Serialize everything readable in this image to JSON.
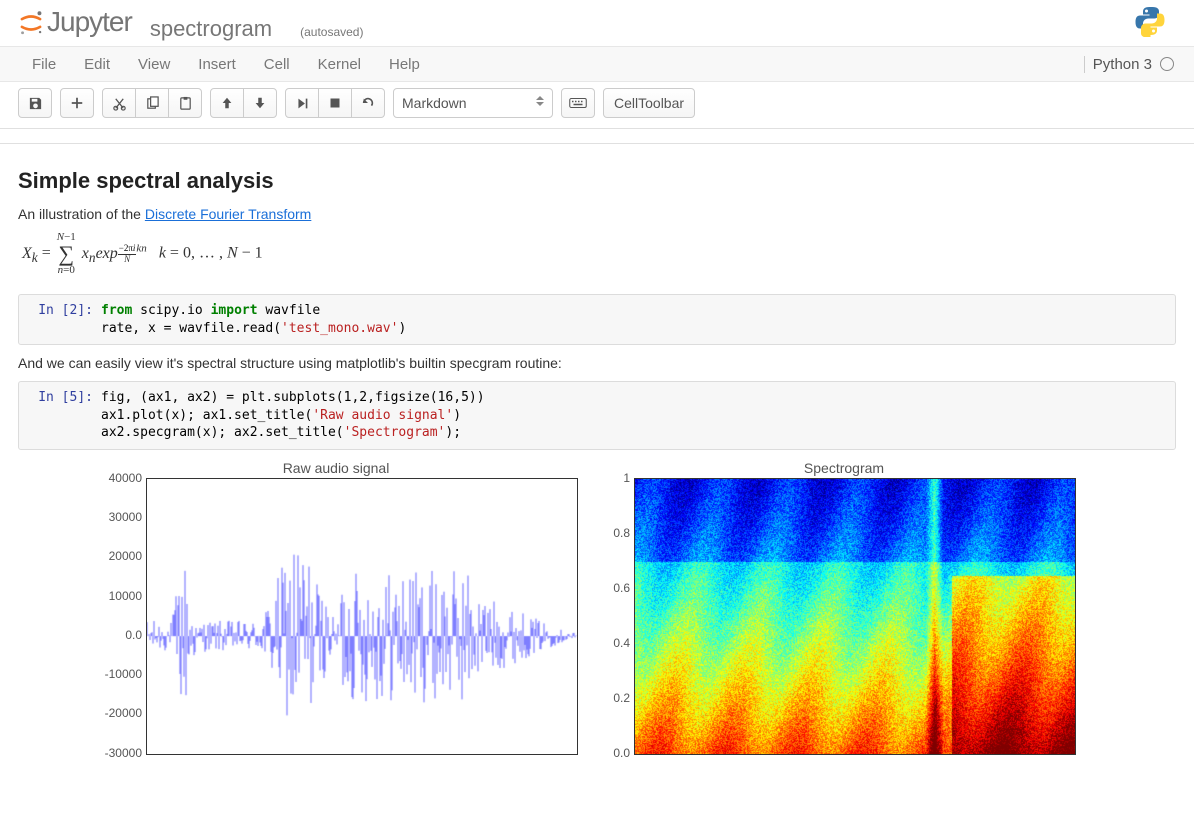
{
  "header": {
    "brand": "Jupyter",
    "notebook_name": "spectrogram",
    "autosave": "(autosaved)"
  },
  "menu": {
    "items": [
      "File",
      "Edit",
      "View",
      "Insert",
      "Cell",
      "Kernel",
      "Help"
    ]
  },
  "kernel": {
    "name": "Python 3"
  },
  "toolbar": {
    "cell_type": "Markdown",
    "celltoolbar_label": "CellToolbar"
  },
  "markdown": {
    "title": "Simple spectral analysis",
    "intro_prefix": "An illustration of the ",
    "intro_link": "Discrete Fourier Transform",
    "equation_caption": "Xk = Σ xn exp(−2πi/N kn)   k = 0,…,N−1",
    "mid_text": "And we can easily view it's spectral structure using matplotlib's builtin specgram routine:"
  },
  "cells": [
    {
      "type": "code",
      "prompt": "In [2]:",
      "lines": [
        [
          {
            "t": "from ",
            "cls": "kw"
          },
          {
            "t": "scipy.io ",
            "cls": "nm"
          },
          {
            "t": "import ",
            "cls": "kw"
          },
          {
            "t": "wavfile",
            "cls": "nm"
          }
        ],
        [
          {
            "t": "rate, x ",
            "cls": "nm"
          },
          {
            "t": "= ",
            "cls": "op"
          },
          {
            "t": "wavfile.read(",
            "cls": "nm"
          },
          {
            "t": "'test_mono.wav'",
            "cls": "str"
          },
          {
            "t": ")",
            "cls": "nm"
          }
        ]
      ]
    },
    {
      "type": "code",
      "prompt": "In [5]:",
      "lines": [
        [
          {
            "t": "fig, (ax1, ax2) ",
            "cls": "nm"
          },
          {
            "t": "= ",
            "cls": "op"
          },
          {
            "t": "plt.subplots(",
            "cls": "nm"
          },
          {
            "t": "1",
            "cls": "num"
          },
          {
            "t": ",",
            "cls": "nm"
          },
          {
            "t": "2",
            "cls": "num"
          },
          {
            "t": ",figsize(",
            "cls": "nm"
          },
          {
            "t": "16",
            "cls": "num"
          },
          {
            "t": ",",
            "cls": "nm"
          },
          {
            "t": "5",
            "cls": "num"
          },
          {
            "t": "))",
            "cls": "nm"
          }
        ],
        [
          {
            "t": "ax1.plot(x); ax1.set_title(",
            "cls": "nm"
          },
          {
            "t": "'Raw audio signal'",
            "cls": "str"
          },
          {
            "t": ")",
            "cls": "nm"
          }
        ],
        [
          {
            "t": "ax2.specgram(x); ax2.set_title(",
            "cls": "nm"
          },
          {
            "t": "'Spectrogram'",
            "cls": "str"
          },
          {
            "t": ");",
            "cls": "nm"
          }
        ]
      ]
    }
  ],
  "chart_data": [
    {
      "type": "line",
      "title": "Raw audio signal",
      "xlabel": "",
      "ylabel": "",
      "ylim": [
        -30000,
        40000
      ],
      "yticks": [
        40000,
        30000,
        20000,
        10000,
        0,
        -10000,
        -20000,
        -30000
      ],
      "series": [
        {
          "name": "amplitude",
          "color": "#0000ff",
          "note": "raw audio waveform (dense oscillation)"
        }
      ]
    },
    {
      "type": "heatmap",
      "title": "Spectrogram",
      "xlabel": "",
      "ylabel": "",
      "ylim": [
        0.0,
        1.0
      ],
      "yticks": [
        1.0,
        0.8,
        0.6,
        0.4,
        0.2,
        0.0
      ],
      "colormap": "jet",
      "note": "matplotlib specgram output: warm colors at low frequencies, cyan at high frequencies"
    }
  ]
}
